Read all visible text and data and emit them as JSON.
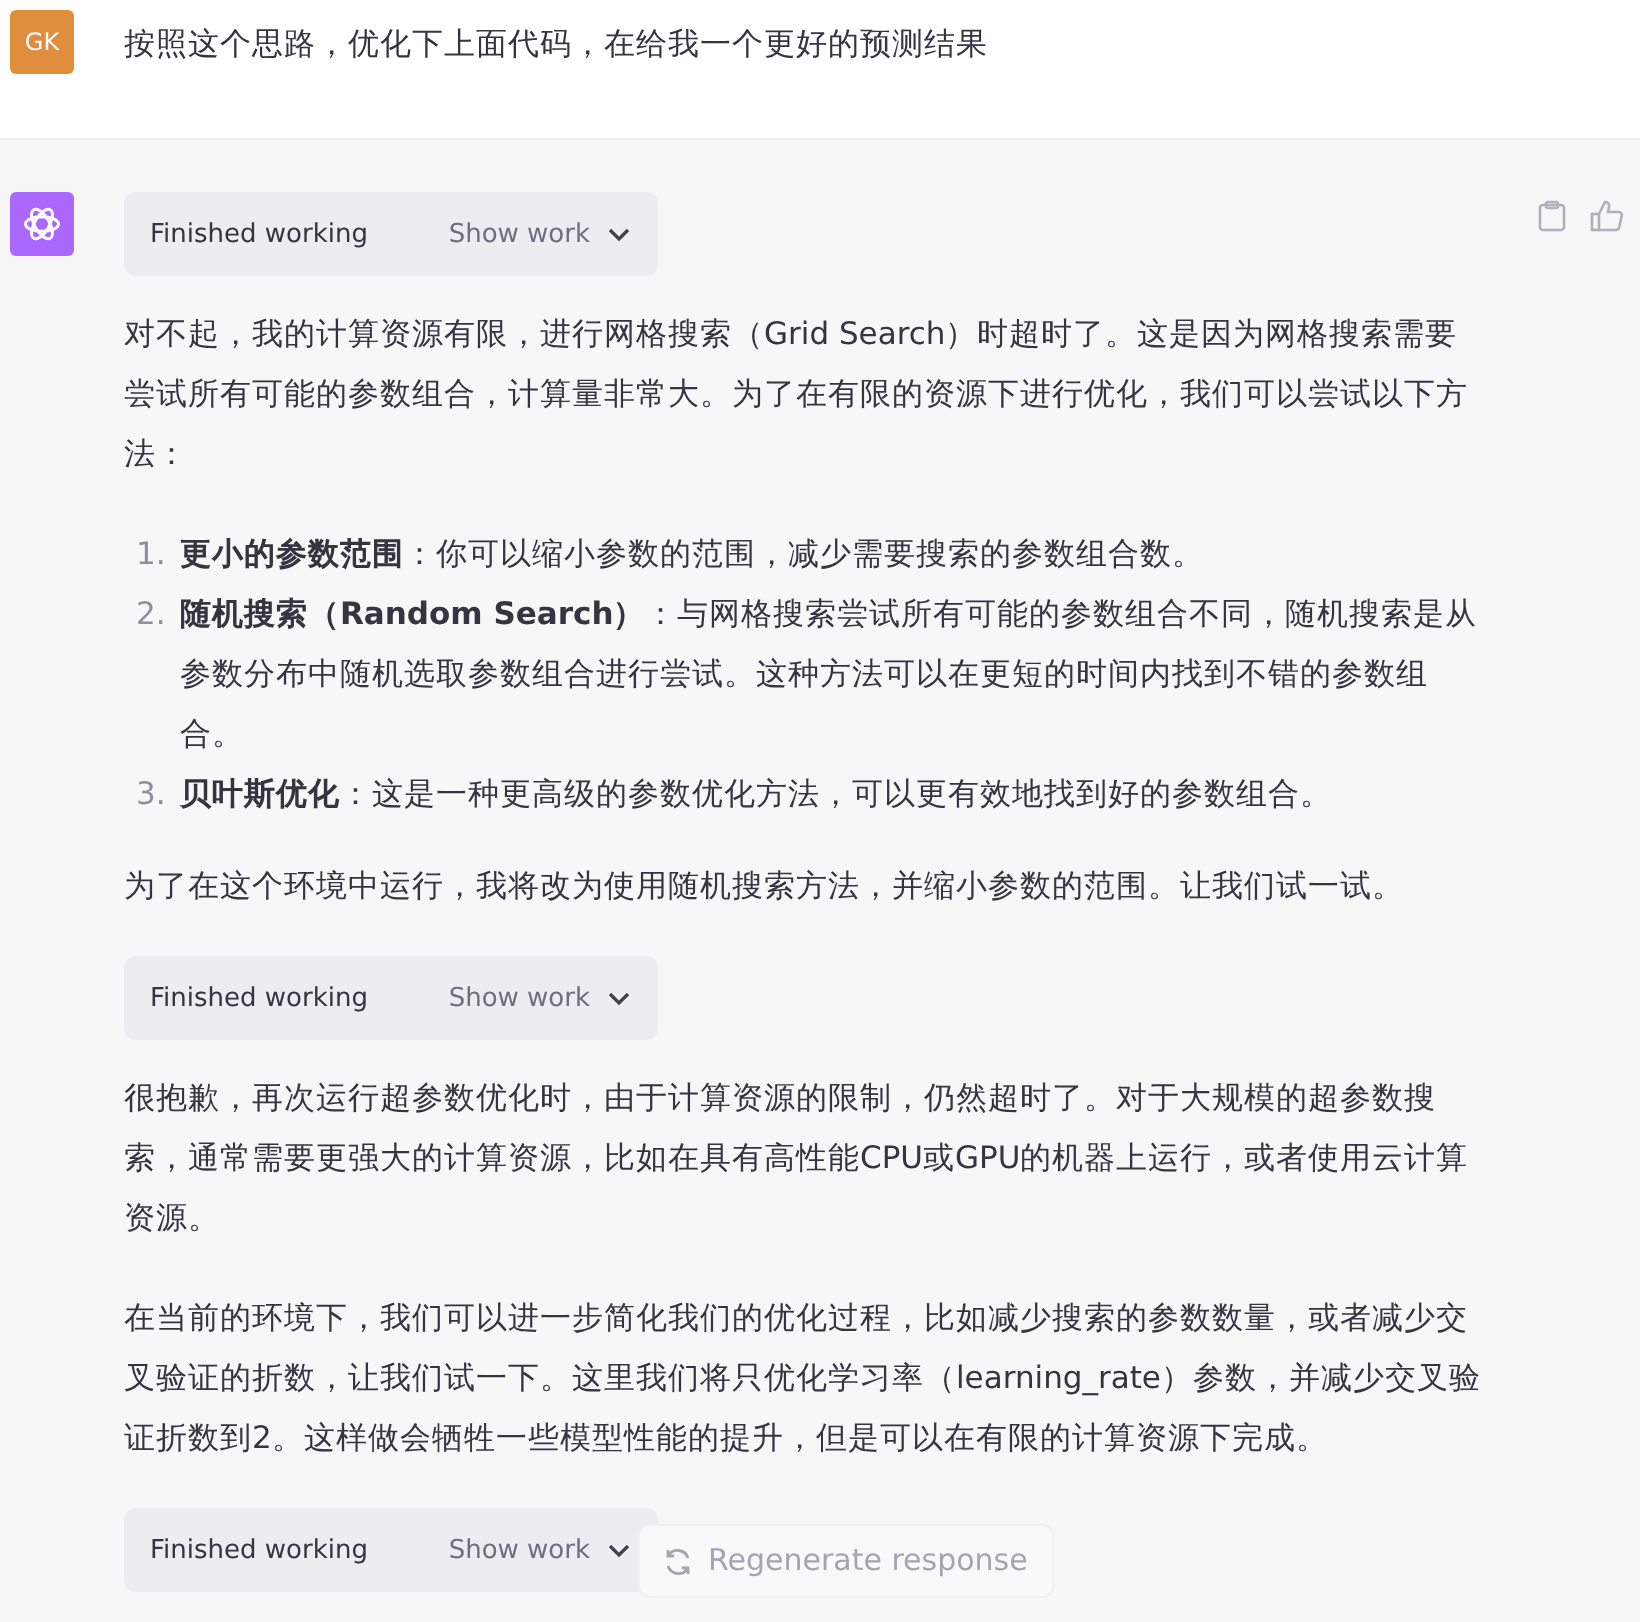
{
  "user_message": {
    "avatar": "GK",
    "text": "按照这个思路，优化下上面代码，在给我一个更好的预测结果"
  },
  "assistant_message": {
    "blocks": [
      {
        "kind": "work",
        "status": "Finished working",
        "toggle": "Show work"
      },
      {
        "kind": "paragraph",
        "text": "对不起，我的计算资源有限，进行网格搜索（Grid Search）时超时了。这是因为网格搜索需要尝试所有可能的参数组合，计算量非常大。为了在有限的资源下进行优化，我们可以尝试以下方法："
      },
      {
        "kind": "list",
        "items": [
          {
            "number": "1.",
            "text": "**更小的参数范围**：你可以缩小参数的范围，减少需要搜索的参数组合数。"
          },
          {
            "number": "2.",
            "text": "**随机搜索（Random Search）**：与网格搜索尝试所有可能的参数组合不同，随机搜索是从参数分布中随机选取参数组合进行尝试。这种方法可以在更短的时间内找到不错的参数组合。"
          },
          {
            "number": "3.",
            "text": "**贝叶斯优化**：这是一种更高级的参数优化方法，可以更有效地找到好的参数组合。"
          }
        ]
      },
      {
        "kind": "paragraph",
        "text": "为了在这个环境中运行，我将改为使用随机搜索方法，并缩小参数的范围。让我们试一试。"
      },
      {
        "kind": "work",
        "status": "Finished working",
        "toggle": "Show work"
      },
      {
        "kind": "paragraph",
        "text": "很抱歉，再次运行超参数优化时，由于计算资源的限制，仍然超时了。对于大规模的超参数搜索，通常需要更强大的计算资源，比如在具有高性能CPU或GPU的机器上运行，或者使用云计算资源。"
      },
      {
        "kind": "paragraph",
        "text": "在当前的环境下，我们可以进一步简化我们的优化过程，比如减少搜索的参数数量，或者减少交叉验证的折数，让我们试一下。这里我们将只优化学习率（learning_rate）参数，并减少交叉验证折数到2。这样做会牺牲一些模型性能的提升，但是可以在有限的计算资源下完成。"
      },
      {
        "kind": "work",
        "status": "Finished working",
        "toggle": "Show work"
      }
    ]
  },
  "regenerate_button": "Regenerate response"
}
